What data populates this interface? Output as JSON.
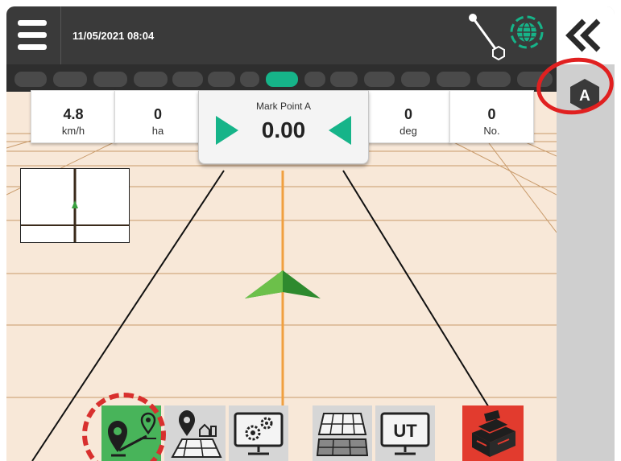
{
  "status_bar": {
    "datetime": "11/05/2021 08:04",
    "icons": [
      "menu-icon",
      "boom-icon",
      "gnss-globe-icon"
    ],
    "gnss_color": "#16b489"
  },
  "section_bar": {
    "segment_count": 16,
    "active_segment": 8,
    "active_color": "#16b489"
  },
  "info": {
    "speed": {
      "value": "4.8",
      "unit": "km/h"
    },
    "area": {
      "value": "0",
      "unit": "ha"
    },
    "center": {
      "title": "Mark Point A",
      "value": "0.00"
    },
    "heading": {
      "value": "0",
      "unit": "deg"
    },
    "count": {
      "value": "0",
      "unit": "No."
    }
  },
  "side_bar": {
    "collapse_icon": "double-chevron-left-icon",
    "mode_badge": "A"
  },
  "bottom_tools": [
    {
      "name": "guidance-mode-button",
      "icon": "ab-line-pin-icon",
      "highlighted": true
    },
    {
      "name": "job-map-button",
      "icon": "field-pin-farm-icon"
    },
    {
      "name": "console-settings-button",
      "icon": "monitor-gears-icon"
    },
    {
      "name": "section-map-button",
      "icon": "coverage-grid-icon"
    },
    {
      "name": "ut-button",
      "icon": "ut-monitor-icon",
      "label": "UT"
    },
    {
      "name": "toolbox-button",
      "icon": "toolbox-icon"
    }
  ],
  "colors": {
    "guidance_bg": "#f8e8d8",
    "accent": "#16b489",
    "highlight_ring": "#e02020",
    "guideline": "#f0a040"
  }
}
